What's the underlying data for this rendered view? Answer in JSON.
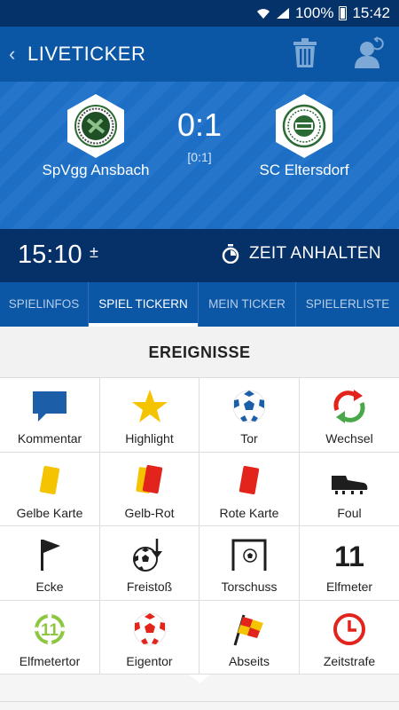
{
  "status_bar": {
    "battery": "100%",
    "time": "15:42"
  },
  "app_bar": {
    "title": "LIVETICKER"
  },
  "match": {
    "home_team": "SpVgg Ansbach",
    "away_team": "SC Eltersdorf",
    "score": "0:1",
    "halftime_score": "[0:1]"
  },
  "timer": {
    "clock": "15:10",
    "adjust": "±",
    "stop_label": "ZEIT ANHALTEN"
  },
  "tabs": [
    {
      "label": "SPIELINFOS",
      "active": false
    },
    {
      "label": "SPIEL TICKERN",
      "active": true
    },
    {
      "label": "MEIN TICKER",
      "active": false
    },
    {
      "label": "SPIELERLISTE",
      "active": false
    }
  ],
  "events_header": "EREIGNISSE",
  "events": [
    {
      "label": "Kommentar",
      "icon": "comment-icon"
    },
    {
      "label": "Highlight",
      "icon": "star-icon"
    },
    {
      "label": "Tor",
      "icon": "ball-icon"
    },
    {
      "label": "Wechsel",
      "icon": "substitution-icon"
    },
    {
      "label": "Gelbe Karte",
      "icon": "yellow-card-icon"
    },
    {
      "label": "Gelb-Rot",
      "icon": "yellow-red-card-icon"
    },
    {
      "label": "Rote Karte",
      "icon": "red-card-icon"
    },
    {
      "label": "Foul",
      "icon": "boot-icon"
    },
    {
      "label": "Ecke",
      "icon": "corner-flag-icon"
    },
    {
      "label": "Freistoß",
      "icon": "free-kick-icon"
    },
    {
      "label": "Torschuss",
      "icon": "shot-on-goal-icon"
    },
    {
      "label": "Elfmeter",
      "icon": "penalty-11-icon",
      "number": "11"
    },
    {
      "label": "Elfmetertor",
      "icon": "penalty-goal-icon",
      "number": "11"
    },
    {
      "label": "Eigentor",
      "icon": "own-goal-icon"
    },
    {
      "label": "Abseits",
      "icon": "offside-flag-icon"
    },
    {
      "label": "Zeitstrafe",
      "icon": "time-penalty-icon"
    }
  ],
  "colors": {
    "status_bar": "#06326a",
    "app_bar": "#0b57a5",
    "score_bg": "#1d6ec5",
    "time_bar": "#063068",
    "accent_blue": "#1c5fa8",
    "yellow": "#f5c400",
    "red": "#e2241c",
    "green": "#7cc242"
  }
}
